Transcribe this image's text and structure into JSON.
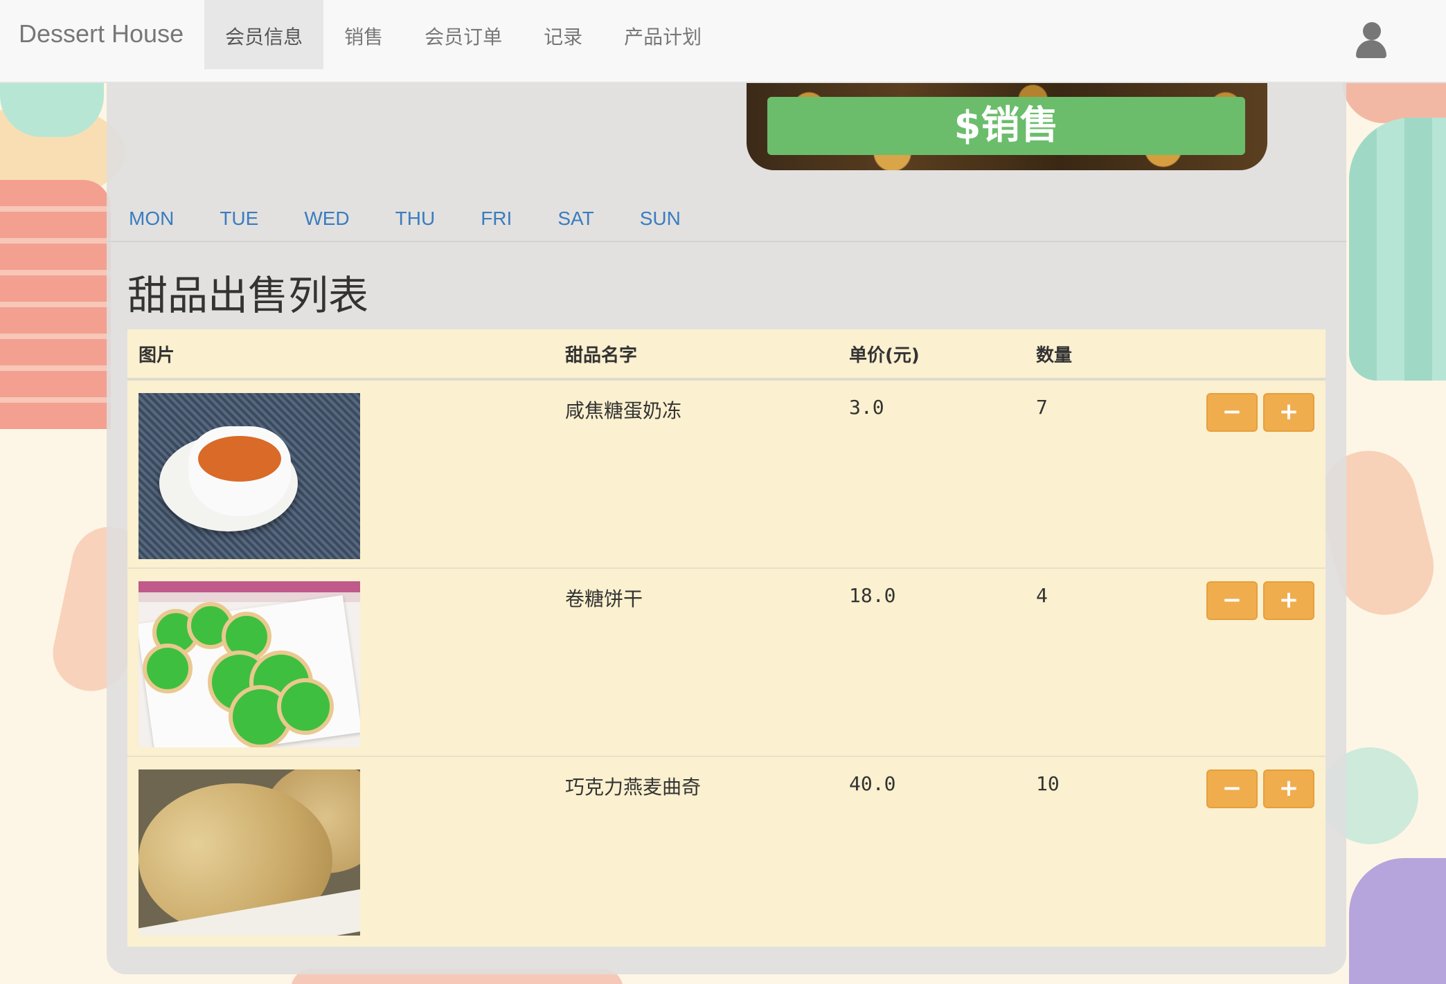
{
  "navbar": {
    "brand": "Dessert House",
    "items": [
      {
        "label": "会员信息",
        "active": true
      },
      {
        "label": "销售",
        "active": false
      },
      {
        "label": "会员订单",
        "active": false
      },
      {
        "label": "记录",
        "active": false
      },
      {
        "label": "产品计划",
        "active": false
      }
    ],
    "user_icon": "user-icon"
  },
  "sale_button": {
    "label": "$销售"
  },
  "days": [
    "MON",
    "TUE",
    "WED",
    "THU",
    "FRI",
    "SAT",
    "SUN"
  ],
  "page_title": "甜品出售列表",
  "table": {
    "headers": {
      "image": "图片",
      "name": "甜品名字",
      "price": "单价(元)",
      "qty": "数量"
    },
    "rows": [
      {
        "image_icon": "salted-caramel-pudding-photo",
        "name": "咸焦糖蛋奶冻",
        "price": "3.0",
        "qty": "7"
      },
      {
        "image_icon": "sugar-cookie-photo",
        "name": "卷糖饼干",
        "price": "18.0",
        "qty": "4"
      },
      {
        "image_icon": "chocolate-oat-cookie-photo",
        "name": "巧克力燕麦曲奇",
        "price": "40.0",
        "qty": "10"
      }
    ],
    "minus_label": "−",
    "plus_label": "+"
  },
  "colors": {
    "accent_orange": "#f0ad4e",
    "sale_green": "#6bbd6b",
    "link_blue": "#3a7cc0",
    "table_bg": "#fbf0cf"
  }
}
